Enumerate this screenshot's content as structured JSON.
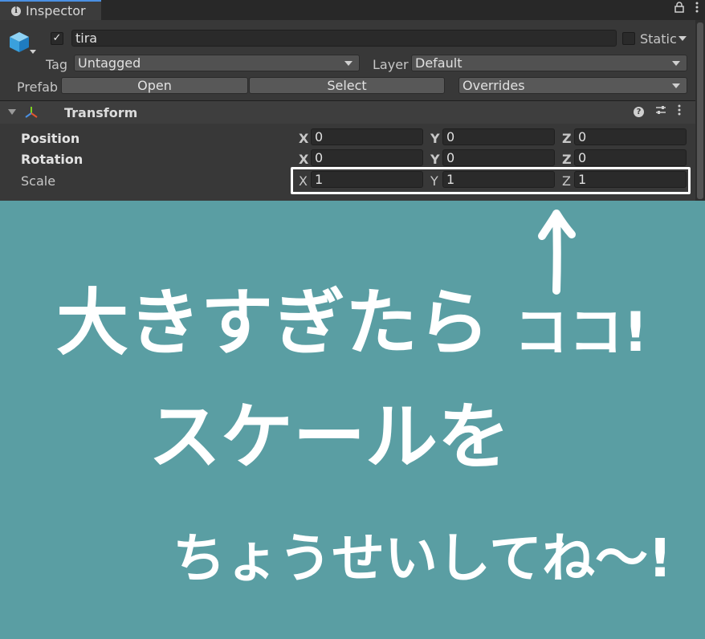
{
  "tab": {
    "title": "Inspector"
  },
  "object": {
    "name": "tira",
    "active": true,
    "static_label": "Static"
  },
  "tag": {
    "label": "Tag",
    "value": "Untagged"
  },
  "layer": {
    "label": "Layer",
    "value": "Default"
  },
  "prefab": {
    "label": "Prefab",
    "open": "Open",
    "select": "Select",
    "overrides": "Overrides"
  },
  "transform": {
    "title": "Transform",
    "rows": [
      {
        "label": "Position",
        "x": "0",
        "y": "0",
        "z": "0"
      },
      {
        "label": "Rotation",
        "x": "0",
        "y": "0",
        "z": "0"
      },
      {
        "label": "Scale",
        "x": "1",
        "y": "1",
        "z": "1"
      }
    ]
  },
  "axes": {
    "x": "X",
    "y": "Y",
    "z": "Z"
  },
  "annotation": {
    "line1": "大きすぎたら",
    "line1b": "ココ!",
    "line2": "スケールを",
    "line3": "ちょうせいしてね〜!",
    "color": "#ffffff"
  },
  "colors": {
    "background": "#5a9ea3",
    "panel": "#383838",
    "highlight": "#ffffff"
  }
}
